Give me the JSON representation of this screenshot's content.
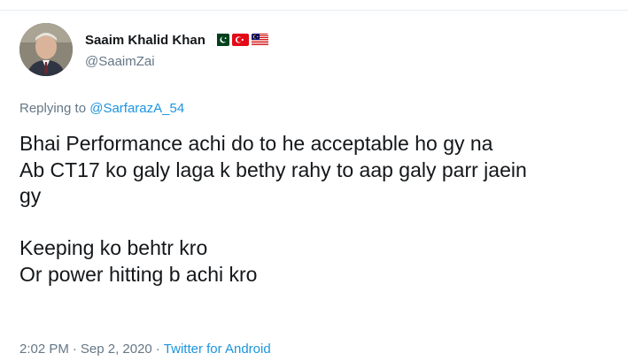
{
  "author": {
    "display_name": "Saaim Khalid Khan",
    "handle": "@SaaimZai",
    "flag_icons": [
      "pakistan-flag-icon",
      "turkey-flag-icon",
      "malaysia-flag-icon"
    ]
  },
  "reply": {
    "prefix": "Replying to",
    "mention": "@SarfarazA_54"
  },
  "tweet": {
    "lines": [
      "Bhai Performance achi do to he acceptable ho gy na",
      "Ab CT17 ko galy laga k bethy rahy to aap galy parr jaein",
      "gy",
      "",
      "Keeping ko behtr kro",
      "Or power hitting b achi kro"
    ]
  },
  "meta": {
    "time": "2:02 PM",
    "separator": "·",
    "date": "Sep 2, 2020",
    "source": "Twitter for Android"
  },
  "colors": {
    "text": "#14171a",
    "muted": "#657786",
    "link": "#1b95e0",
    "divider": "#e6ecf0"
  }
}
